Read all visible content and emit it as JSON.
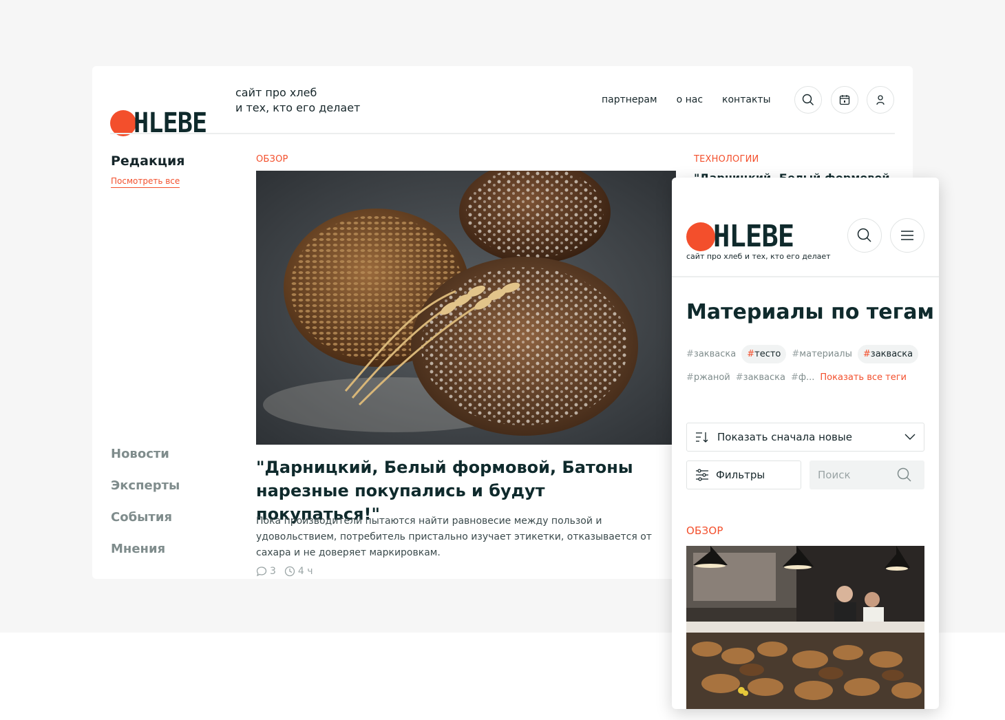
{
  "brand": {
    "logo_text": "HLEBE",
    "color": "#f34f2c",
    "dark": "#0f2a2c"
  },
  "desktop": {
    "tagline_line1": "сайт про хлеб",
    "tagline_line2": "и тех, кто его делает",
    "nav": [
      "партнерам",
      "о нас",
      "контакты"
    ],
    "icons": [
      "search-icon",
      "calendar-icon",
      "user-icon"
    ],
    "sidebar": {
      "title": "Редакция",
      "see_all": "Посмотреть все",
      "items": [
        "Новости",
        "Эксперты",
        "События",
        "Мнения"
      ]
    },
    "article": {
      "category": "ОБЗОР",
      "title": "\"Дарницкий, Белый формовой, Батоны нарезные покупались и будут покупаться!\"",
      "lead": "Пока производители пытаются найти равновесие между пользой и удовольствием, потребитель пристально изучает этикетки, отказывается от сахара и не доверяет маркировкам.",
      "comments": "3",
      "time": "4 ч"
    },
    "side_article": {
      "category": "ТЕХНОЛОГИИ",
      "title": "\"Дарницкий, Белый формовой"
    }
  },
  "mobile": {
    "tagline": "сайт про хлеб и тех, кто его делает",
    "heading": "Материалы по тегам",
    "tags_row1": [
      {
        "label": "закваска",
        "active": false
      },
      {
        "label": "тесто",
        "active": true
      },
      {
        "label": "материалы",
        "active": false
      },
      {
        "label": "закваска",
        "active": true
      }
    ],
    "tags_row2": [
      {
        "label": "ржаной",
        "active": false
      },
      {
        "label": "закваска",
        "active": false
      },
      {
        "label": "ф...",
        "active": false
      }
    ],
    "hash": "#",
    "show_all_tags": "Показать все теги",
    "sort_label": "Показать сначала новые",
    "filters_label": "Фильтры",
    "search_placeholder": "Поиск",
    "category": "ОБЗОР"
  }
}
